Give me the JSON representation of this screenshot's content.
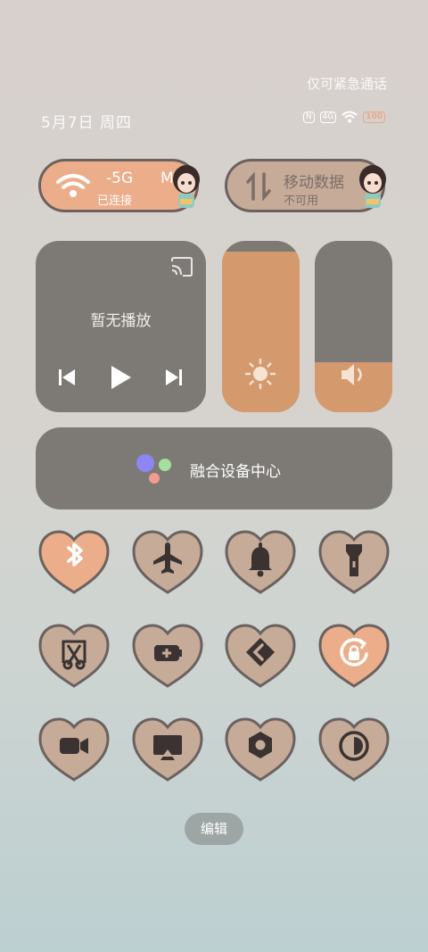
{
  "status": {
    "emergency": "仅可紧急通话",
    "date": "5月7日 周四",
    "badge_nfc": "N",
    "badge_signal": "4G",
    "badge_battery": "100"
  },
  "wifi": {
    "name": "-5G",
    "extra": "M",
    "status": "已连接"
  },
  "mobile_data": {
    "title": "移动数据",
    "status": "不可用"
  },
  "media": {
    "title": "暂无播放"
  },
  "brightness": {
    "level": 0.94
  },
  "volume": {
    "level": 0.29
  },
  "hub": {
    "label": "融合设备中心"
  },
  "toggles": [
    {
      "name": "bluetooth",
      "active": true
    },
    {
      "name": "airplane",
      "active": false
    },
    {
      "name": "ring",
      "active": false
    },
    {
      "name": "flashlight",
      "active": false
    },
    {
      "name": "screenshot",
      "active": false
    },
    {
      "name": "battery-saver",
      "active": false
    },
    {
      "name": "share",
      "active": false
    },
    {
      "name": "rotation-lock",
      "active": true
    },
    {
      "name": "screen-record",
      "active": false
    },
    {
      "name": "screen-cast",
      "active": false
    },
    {
      "name": "settings",
      "active": false
    },
    {
      "name": "dark-mode",
      "active": false
    }
  ],
  "edit_label": "编辑",
  "colors": {
    "active": "#ecae8a",
    "inactive": "#c5ab98",
    "outline": "#6b6260",
    "tile": "#7d7a76",
    "fill": "#d49a6e"
  }
}
